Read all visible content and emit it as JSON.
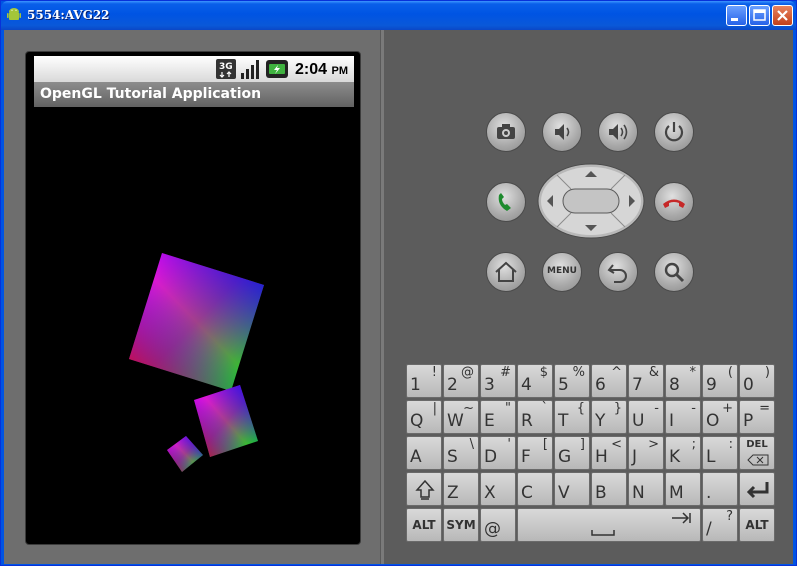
{
  "window": {
    "title": "5554:AVG22",
    "icon": "android-icon"
  },
  "window_buttons": [
    "minimize-icon",
    "maximize-icon",
    "close-icon"
  ],
  "status_bar": {
    "network": "3G",
    "time": "2:04",
    "ampm": "PM"
  },
  "app": {
    "title": "OpenGL Tutorial Application"
  },
  "controls": {
    "row1": [
      "camera-icon",
      "volume-down-icon",
      "volume-up-icon",
      "power-icon"
    ],
    "row2": [
      "call-icon",
      "dpad",
      "end-call-icon"
    ],
    "row3": [
      "home-icon",
      "MENU",
      "back-icon",
      "search-icon"
    ]
  },
  "keyboard": {
    "row1": [
      [
        "1",
        "!"
      ],
      [
        "2",
        "@"
      ],
      [
        "3",
        "#"
      ],
      [
        "4",
        "$"
      ],
      [
        "5",
        "%"
      ],
      [
        "6",
        "^"
      ],
      [
        "7",
        "&"
      ],
      [
        "8",
        "*"
      ],
      [
        "9",
        "("
      ],
      [
        "0",
        ")"
      ]
    ],
    "row2": [
      [
        "Q",
        "|"
      ],
      [
        "W",
        "~"
      ],
      [
        "E",
        "\""
      ],
      [
        "R",
        "`"
      ],
      [
        "T",
        "{"
      ],
      [
        "Y",
        "}"
      ],
      [
        "U",
        "-"
      ],
      [
        "I",
        "-"
      ],
      [
        "O",
        "+"
      ],
      [
        "P",
        "="
      ]
    ],
    "row3": [
      [
        "A",
        ""
      ],
      [
        "S",
        "\\"
      ],
      [
        "D",
        "'"
      ],
      [
        "F",
        "["
      ],
      [
        "G",
        "]"
      ],
      [
        "H",
        "<"
      ],
      [
        "J",
        ">"
      ],
      [
        "K",
        ";"
      ],
      [
        "L",
        ":"
      ]
    ],
    "del_label": "DEL",
    "row4": [
      [
        "Z",
        ""
      ],
      [
        "X",
        ""
      ],
      [
        "C",
        ""
      ],
      [
        "V",
        ""
      ],
      [
        "B",
        ""
      ],
      [
        "N",
        ""
      ],
      [
        "M",
        ""
      ],
      [
        ".",
        ""
      ]
    ],
    "alt_label": "ALT",
    "sym_label": "SYM",
    "at_label": "@",
    "slash": [
      "/",
      "?"
    ],
    "comma": [
      ",",
      "'"
    ]
  }
}
